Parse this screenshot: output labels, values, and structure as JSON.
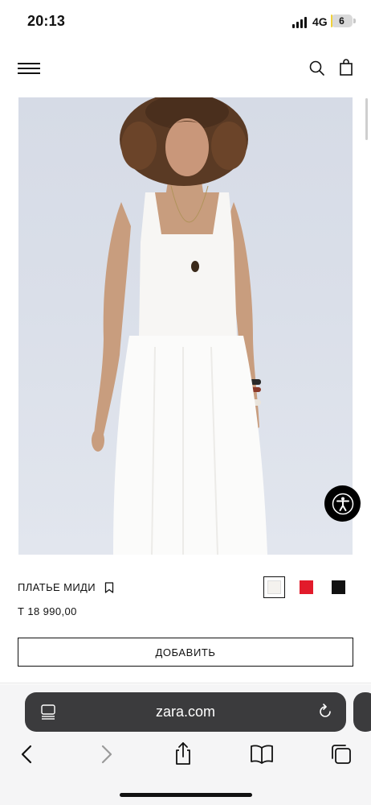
{
  "status_bar": {
    "time": "20:13",
    "network": "4G",
    "battery_level": "6",
    "battery_fraction": 0.06
  },
  "header": {
    "menu_icon": "hamburger-menu-icon",
    "search_icon": "search-icon",
    "cart_icon": "shopping-bag-icon"
  },
  "product": {
    "image_icon": "product-photo",
    "name": "ПЛАТЬЕ МИДИ",
    "price": "Т 18 990,00",
    "colors": [
      "#f4f2ee",
      "#e21b2b",
      "#111111"
    ],
    "selected_color_index": 0,
    "add_button_label": "ДОБАВИТЬ"
  },
  "accessibility": {
    "icon": "accessibility-icon"
  },
  "browser": {
    "url": "zara.com",
    "left_icon": "tab-list-icon",
    "reload_icon": "reload-icon",
    "nav": [
      "back-icon",
      "forward-icon",
      "share-icon",
      "bookmarks-icon",
      "tabs-icon"
    ]
  }
}
